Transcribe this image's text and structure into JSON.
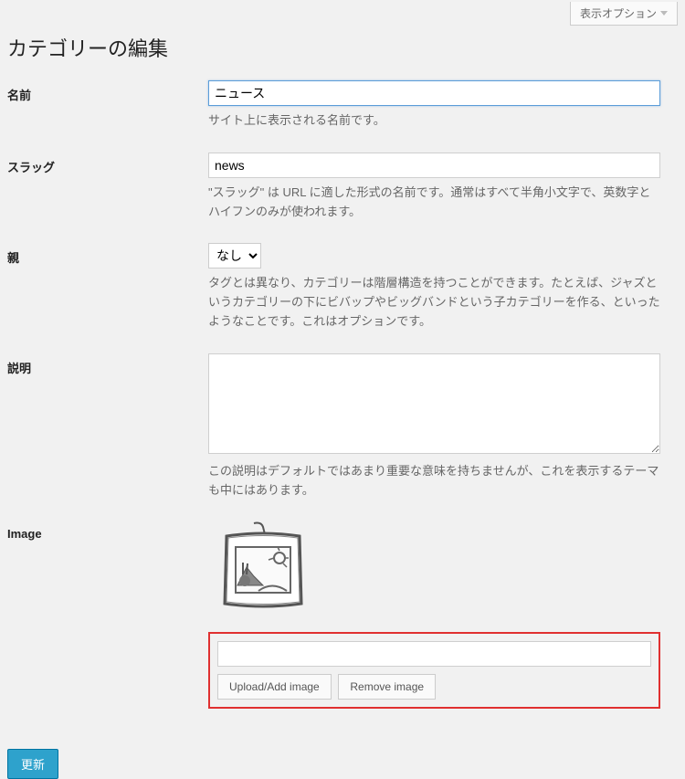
{
  "screen_options_label": "表示オプション",
  "page_title": "カテゴリーの編集",
  "fields": {
    "name": {
      "label": "名前",
      "value": "ニュース",
      "description": "サイト上に表示される名前です。"
    },
    "slug": {
      "label": "スラッグ",
      "value": "news",
      "description": "\"スラッグ\" は URL に適した形式の名前です。通常はすべて半角小文字で、英数字とハイフンのみが使われます。"
    },
    "parent": {
      "label": "親",
      "selected": "なし",
      "description": "タグとは異なり、カテゴリーは階層構造を持つことができます。たとえば、ジャズというカテゴリーの下にビバップやビッグバンドという子カテゴリーを作る、といったようなことです。これはオプションです。"
    },
    "description": {
      "label": "説明",
      "value": "",
      "description": "この説明はデフォルトではあまり重要な意味を持ちませんが、これを表示するテーマも中にはあります。"
    },
    "image": {
      "label": "Image",
      "upload_value": "",
      "upload_button": "Upload/Add image",
      "remove_button": "Remove image"
    }
  },
  "submit_label": "更新"
}
